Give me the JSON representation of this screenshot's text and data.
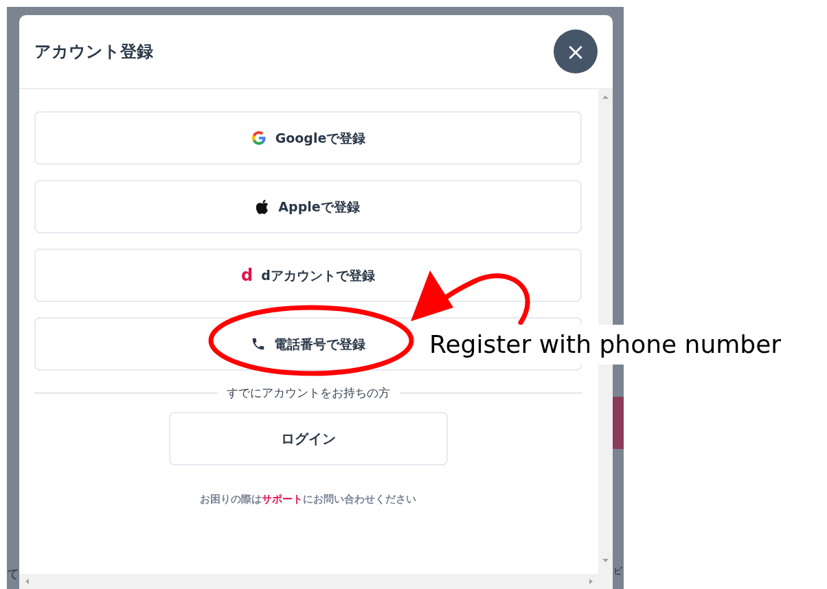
{
  "background_fragments": {
    "left": [
      "て"
    ],
    "right": [
      "ビ"
    ]
  },
  "modal": {
    "title": "アカウント登録",
    "close_label": "×",
    "providers": [
      {
        "kind": "google",
        "label": "Googleで登録"
      },
      {
        "kind": "apple",
        "label": "Appleで登録"
      },
      {
        "kind": "docomo",
        "icon_text": "d",
        "label": "dアカウントで登録"
      },
      {
        "kind": "phone",
        "label": "電話番号で登録"
      }
    ],
    "divider_text": "すでにアカウントをお持ちの方",
    "login_button": "ログイン",
    "help": {
      "before": "お困りの際は",
      "link": "サポート",
      "after": "にお問い合わせください"
    }
  },
  "annotation": {
    "callout": "Register with phone number"
  }
}
